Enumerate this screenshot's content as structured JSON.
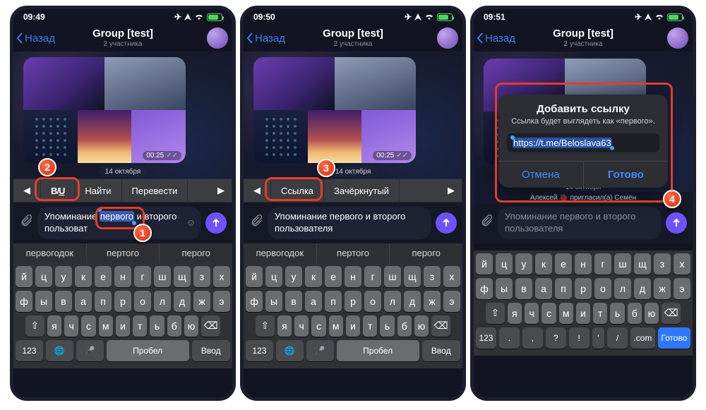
{
  "status": {
    "time1": "09:49",
    "time2": "09:50",
    "time3": "09:51",
    "airplane": "✈︎"
  },
  "header": {
    "back": "Назад",
    "group": "Group [test]",
    "sub": "2 участника"
  },
  "msg": {
    "img_time": "00:25",
    "date": "14 октября",
    "invite": "Алексей 🐞 пригласил(а) Семён"
  },
  "ctx1": {
    "find": "Найти",
    "translate": "Перевести"
  },
  "ctx2": {
    "link": "Ссылка",
    "strike": "Зачёркнутый"
  },
  "input": {
    "text_pre": "Упоминание ",
    "sel_word": "первого",
    "text_rest1": " и второго пользоват",
    "full2": "Упоминание первого и второго пользователя",
    "placeholder3": "Упоминание первого и второго пользователя"
  },
  "suggest": {
    "a": "первогодок",
    "b": "пертого",
    "c": "перого"
  },
  "dialog": {
    "title": "Добавить ссылку",
    "sub": "Ссылка будет выглядеть как «первого».",
    "url": "https://t.me/Beloslava63",
    "cancel": "Отмена",
    "ok": "Готово"
  },
  "kb": {
    "r1": "йцукенгшщзх",
    "r2": "фывапролджэ",
    "r3_mid": "ячсмитьбю",
    "num": "123",
    "space": "Пробел",
    "enter": "Ввод",
    "done": "Готово",
    "dot": ".",
    "comma": ",",
    "qmark": "?",
    "bang": "!",
    "slash": "/",
    "com": ".com"
  },
  "badges": {
    "b1": "1",
    "b2": "2",
    "b3": "3",
    "b4": "4"
  }
}
